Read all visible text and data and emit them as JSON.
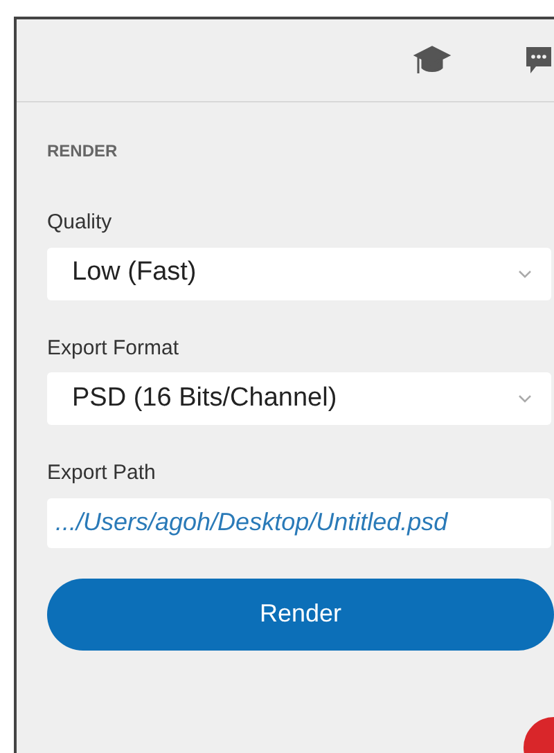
{
  "section": {
    "title": "RENDER"
  },
  "fields": [
    {
      "kind": "select",
      "label": "Quality",
      "value": "Low (Fast)"
    },
    {
      "kind": "select",
      "label": "Export Format",
      "value": "PSD (16 Bits/Channel)"
    },
    {
      "kind": "path",
      "label": "Export Path",
      "value": ".../Users/agoh/Desktop/Untitled.psd"
    }
  ],
  "button": {
    "label": "Render"
  }
}
